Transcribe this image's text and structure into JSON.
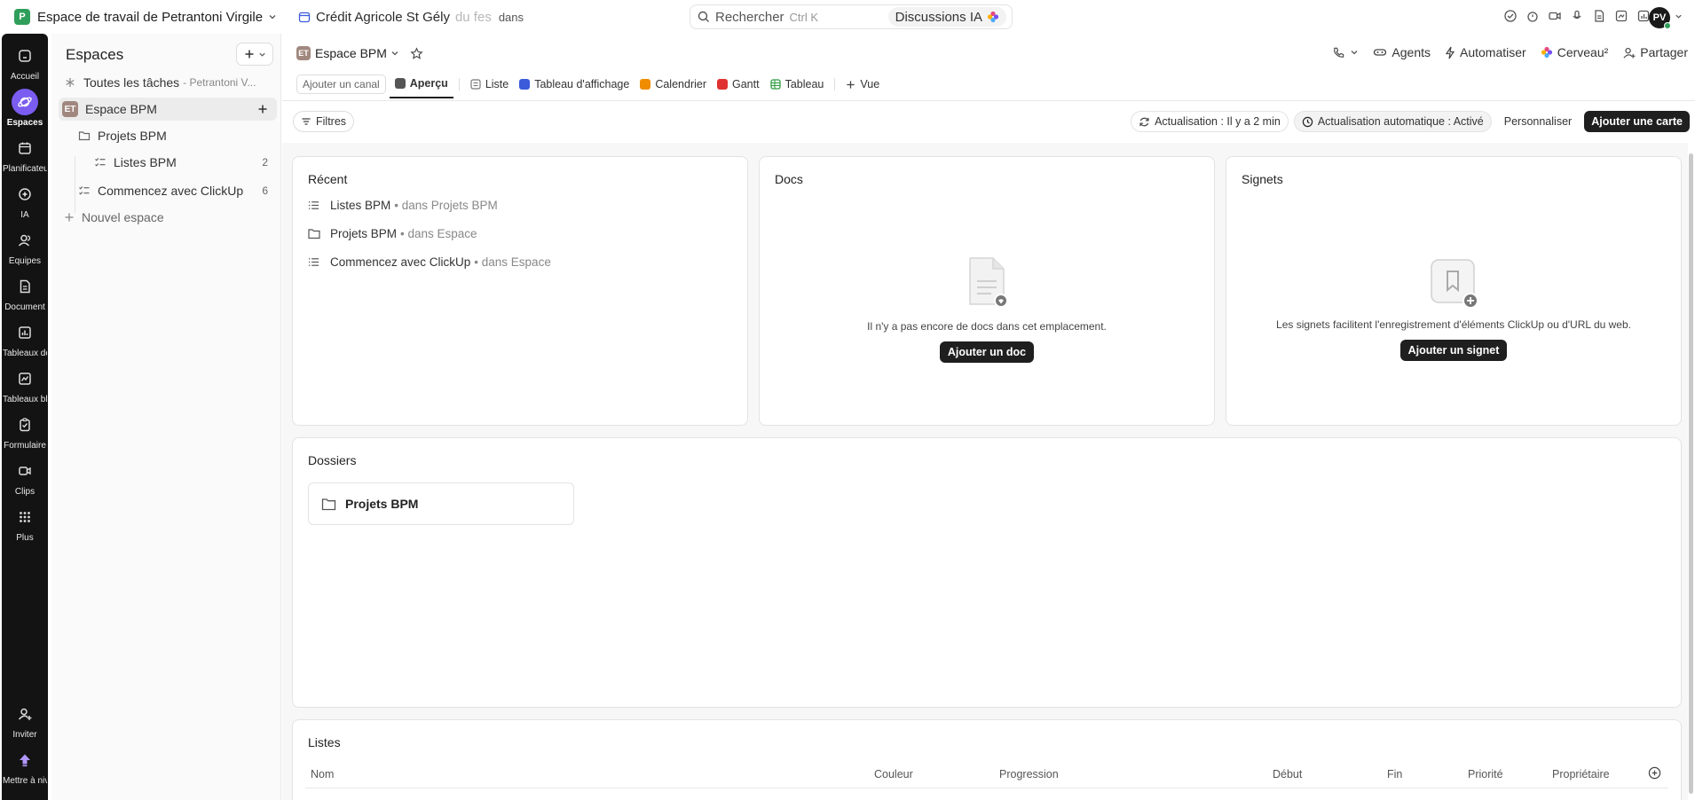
{
  "topbar": {
    "workspace_initial": "P",
    "workspace_name": "Espace de travail de Petrantoni Virgile",
    "crumb_title": "Crédit Agricole St Gély",
    "crumb_fade": "du fes",
    "crumb_dans": "dans",
    "search_placeholder": "Rechercher",
    "search_shortcut": "Ctrl K",
    "ai_label": "Discussions IA",
    "avatar_initials": "PV"
  },
  "rail": {
    "items": [
      {
        "label": "Accueil",
        "icon": "home-icon"
      },
      {
        "label": "Espaces",
        "icon": "planet-icon"
      },
      {
        "label": "Planificateur",
        "icon": "calendar-icon"
      },
      {
        "label": "IA",
        "icon": "ai-icon"
      },
      {
        "label": "Équipes",
        "icon": "team-icon"
      },
      {
        "label": "Document",
        "icon": "doc-icon"
      },
      {
        "label": "Tableaux de bord",
        "icon": "dashboard-icon"
      },
      {
        "label": "Tableaux blancs",
        "icon": "whiteboard-icon"
      },
      {
        "label": "Formulaire",
        "icon": "form-icon"
      },
      {
        "label": "Clips",
        "icon": "clip-icon"
      },
      {
        "label": "Plus",
        "icon": "grid-icon"
      }
    ],
    "invite_label": "Inviter",
    "upgrade_label": "Mettre à niveau"
  },
  "sidebar": {
    "title": "Espaces",
    "all_tasks": "Toutes les tâches",
    "all_tasks_owner": "- Petrantoni V...",
    "space_badge": "ET",
    "space_name": "Espace BPM",
    "folder_name": "Projets BPM",
    "list_name": "Listes BPM",
    "list_count": "2",
    "getting_started": "Commencez avec ClickUp",
    "getting_started_count": "6",
    "new_space": "Nouvel espace"
  },
  "header": {
    "space_badge": "ET",
    "space_name": "Espace BPM",
    "agents": "Agents",
    "automate": "Automatiser",
    "brain": "Cerveau²",
    "share": "Partager",
    "add_channel": "Ajouter un canal",
    "tabs": [
      {
        "label": "Aperçu",
        "color": "#555555"
      },
      {
        "label": "Liste",
        "color": "#777777"
      },
      {
        "label": "Tableau d'affichage",
        "color": "#3b5bdb"
      },
      {
        "label": "Calendrier",
        "color": "#f08c00"
      },
      {
        "label": "Gantt",
        "color": "#e03131"
      },
      {
        "label": "Tableau",
        "color": "#2f9e44"
      }
    ],
    "add_view": "Vue"
  },
  "toolbar": {
    "filters": "Filtres",
    "refresh": "Actualisation : Il y a 2 min",
    "auto_refresh": "Actualisation automatique : Activé",
    "customize": "Personnaliser",
    "add_card": "Ajouter une carte"
  },
  "recent": {
    "title": "Récent",
    "items": [
      {
        "name": "Listes BPM",
        "sub": "• dans Projets BPM"
      },
      {
        "name": "Projets BPM",
        "sub": "• dans Espace"
      },
      {
        "name": "Commencez avec ClickUp",
        "sub": "• dans Espace"
      }
    ]
  },
  "docs": {
    "title": "Docs",
    "empty_msg": "Il n'y a pas encore de docs dans cet emplacement.",
    "button": "Ajouter un doc"
  },
  "bookmarks": {
    "title": "Signets",
    "empty_msg": "Les signets facilitent l'enregistrement d'éléments ClickUp ou d'URL du web.",
    "button": "Ajouter un signet"
  },
  "folders": {
    "title": "Dossiers",
    "item": "Projets BPM"
  },
  "lists": {
    "title": "Listes",
    "columns": [
      "Nom",
      "Couleur",
      "Progression",
      "Début",
      "Fin",
      "Priorité",
      "Propriétaire"
    ]
  }
}
